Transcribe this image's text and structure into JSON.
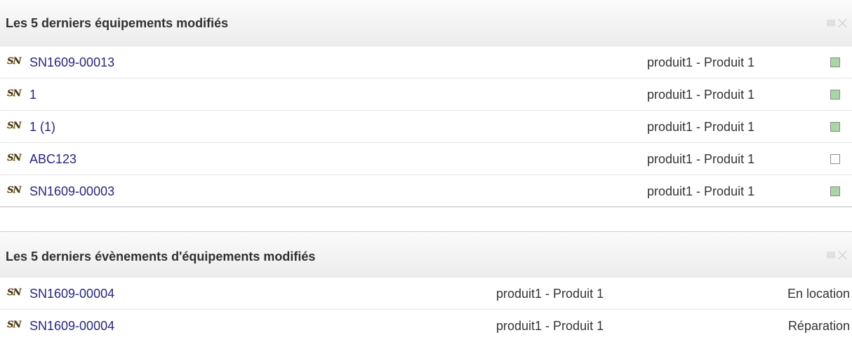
{
  "recent_equipment": {
    "title": "Les 5 derniers équipements modifiés",
    "rows": [
      {
        "icon": "SN",
        "ref": "SN1609-00013",
        "product": "produit1 - Produit 1",
        "status_color": "#a9d6a5"
      },
      {
        "icon": "SN",
        "ref": "1",
        "product": "produit1 - Produit 1",
        "status_color": "#a9d6a5"
      },
      {
        "icon": "SN",
        "ref": "1 (1)",
        "product": "produit1 - Produit 1",
        "status_color": "#a9d6a5"
      },
      {
        "icon": "SN",
        "ref": "ABC123",
        "product": "produit1 - Produit 1",
        "status_color": "#ffffff"
      },
      {
        "icon": "SN",
        "ref": "SN1609-00003",
        "product": "produit1 - Produit 1",
        "status_color": "#a9d6a5"
      }
    ]
  },
  "recent_events": {
    "title": "Les 5 derniers évènements d'équipements modifiés",
    "rows": [
      {
        "icon": "SN",
        "ref": "SN1609-00004",
        "product": "produit1 - Produit 1",
        "status": "En location"
      },
      {
        "icon": "SN",
        "ref": "SN1609-00004",
        "product": "produit1 - Produit 1",
        "status": "Réparation"
      }
    ]
  }
}
